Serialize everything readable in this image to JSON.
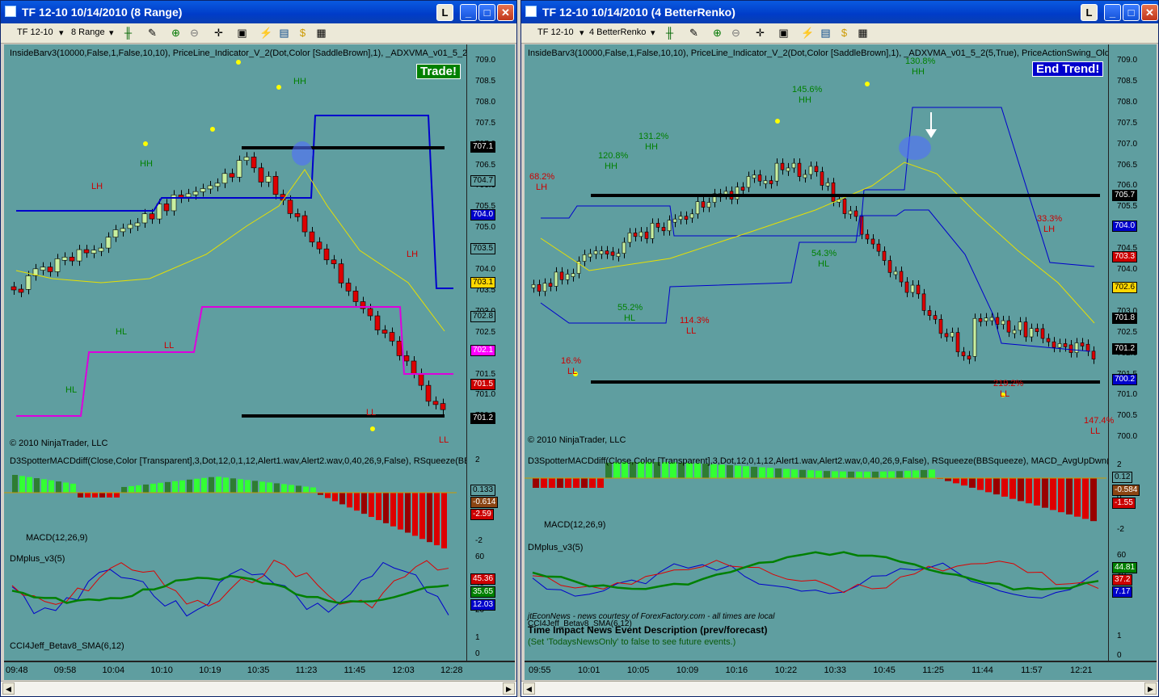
{
  "left": {
    "title": "TF 12-10  10/14/2010 (8 Range)",
    "toolbar": {
      "instrument": "TF 12-10",
      "period": "8 Range"
    },
    "indicator_header": "InsideBarv3(10000,False,1,False,10,10), PriceLine_Indicator_V_2(Dot,Color [SaddleBrown],1), _ADXVMA_v01_5_2(5,True), Pric",
    "signal": "Trade!",
    "copyright": "© 2010 NinjaTrader, LLC",
    "price_ticks": [
      "709.0",
      "708.5",
      "708.0",
      "707.5",
      "707.0",
      "706.5",
      "706.0",
      "705.5",
      "705.0",
      "704.5",
      "704.0",
      "703.5",
      "703.0",
      "702.5",
      "702.0",
      "701.5",
      "701.0",
      "700.5"
    ],
    "price_tags": [
      {
        "text": "707.1",
        "bg": "#000000",
        "fg": "#ffffff"
      },
      {
        "text": "704.7",
        "bg": "#5f9ea0",
        "fg": "#000000"
      },
      {
        "text": "704.0",
        "bg": "#0000cc",
        "fg": "#ffffff"
      },
      {
        "text": "703.5",
        "bg": "#5f9ea0",
        "fg": "#000000"
      },
      {
        "text": "703.1",
        "bg": "#ffd700",
        "fg": "#000000"
      },
      {
        "text": "702.8",
        "bg": "#5f9ea0",
        "fg": "#000000"
      },
      {
        "text": "702.1",
        "bg": "#ff00ff",
        "fg": "#ffffff"
      },
      {
        "text": "701.5",
        "bg": "#cc0000",
        "fg": "#ffffff"
      },
      {
        "text": "701.2",
        "bg": "#000000",
        "fg": "#ffffff"
      }
    ],
    "labels": [
      "HH",
      "HH",
      "LH",
      "HL",
      "LL",
      "HL",
      "LH",
      "LL",
      "LL"
    ],
    "macd_header": "D3SpotterMACDdiff(Close,Color [Transparent],3,Dot,12,0,1,12,Alert1.wav,Alert2.wav,0,40,26,9,False), RSqueeze(BBSqueeze), M",
    "macd_label": "MACD(12,26,9)",
    "macd_ticks": [
      "2",
      "0",
      "-2"
    ],
    "macd_tags": [
      {
        "text": "0.133",
        "bg": "#5f9ea0",
        "fg": "#000000"
      },
      {
        "text": "-0.614",
        "bg": "#8b4513",
        "fg": "#ffffff"
      },
      {
        "text": "-2.59",
        "bg": "#cc0000",
        "fg": "#ffffff"
      }
    ],
    "dm_label": "DMplus_v3(5)",
    "dm_ticks": [
      "60",
      "40",
      "20"
    ],
    "dm_tags": [
      {
        "text": "45.36",
        "bg": "#cc0000",
        "fg": "#ffffff"
      },
      {
        "text": "35.65",
        "bg": "#008000",
        "fg": "#ffffff"
      },
      {
        "text": "12.03",
        "bg": "#0000cc",
        "fg": "#ffffff"
      }
    ],
    "cci_label": "CCI4Jeff_Betav8_SMA(6,12)",
    "cci_ticks": [
      "1",
      "0"
    ],
    "time_ticks": [
      "09:48",
      "09:58",
      "10:04",
      "10:10",
      "10:19",
      "10:35",
      "11:23",
      "11:45",
      "12:03",
      "12:28"
    ]
  },
  "right": {
    "title": "TF 12-10  10/14/2010 (4 BetterRenko)",
    "toolbar": {
      "instrument": "TF 12-10",
      "period": "4 BetterRenko"
    },
    "indicator_header": "InsideBarv3(10000,False,1,False,10,10), PriceLine_Indicator_V_2(Dot,Color [SaddleBrown],1), _ADXVMA_v01_5_2(5,True), PriceActionSwing_Old(Standard,4,1",
    "signal": "End Trend!",
    "copyright": "© 2010 NinjaTrader, LLC",
    "price_ticks": [
      "709.0",
      "708.5",
      "708.0",
      "707.5",
      "707.0",
      "706.5",
      "706.0",
      "705.5",
      "705.0",
      "704.5",
      "704.0",
      "703.5",
      "703.0",
      "702.5",
      "702.0",
      "701.5",
      "701.0",
      "700.5",
      "700.0"
    ],
    "price_tags": [
      {
        "text": "705.7",
        "bg": "#000000",
        "fg": "#ffffff"
      },
      {
        "text": "704.0",
        "bg": "#0000cc",
        "fg": "#ffffff"
      },
      {
        "text": "703.3",
        "bg": "#cc0000",
        "fg": "#ffffff"
      },
      {
        "text": "702.6",
        "bg": "#ffd700",
        "fg": "#000000"
      },
      {
        "text": "701.8",
        "bg": "#000000",
        "fg": "#ffffff"
      },
      {
        "text": "701.2",
        "bg": "#000000",
        "fg": "#ffffff"
      },
      {
        "text": "700.2",
        "bg": "#0000cc",
        "fg": "#ffffff"
      }
    ],
    "swing_labels": [
      {
        "pct": "68.2%",
        "lab": "LH",
        "color": "#cc0000"
      },
      {
        "pct": "120.8%",
        "lab": "HH",
        "color": "#008000"
      },
      {
        "pct": "131.2%",
        "lab": "HH",
        "color": "#008000"
      },
      {
        "pct": "145.6%",
        "lab": "HH",
        "color": "#008000"
      },
      {
        "pct": "130.8%",
        "lab": "HH",
        "color": "#008000"
      },
      {
        "pct": "54.3%",
        "lab": "HL",
        "color": "#008000"
      },
      {
        "pct": "55.2%",
        "lab": "HL",
        "color": "#008000"
      },
      {
        "pct": "114.3%",
        "lab": "LL",
        "color": "#cc0000"
      },
      {
        "pct": "16.%",
        "lab": "LL",
        "color": "#cc0000"
      },
      {
        "pct": "33.3%",
        "lab": "LH",
        "color": "#cc0000"
      },
      {
        "pct": "219.2%",
        "lab": "LL",
        "color": "#cc0000"
      },
      {
        "pct": "147.4%",
        "lab": "LL",
        "color": "#cc0000"
      }
    ],
    "macd_header": "D3SpotterMACDdiff(Close,Color [Transparent],3,Dot,12,0,1,12,Alert1.wav,Alert2.wav,0,40,26,9,False), RSqueeze(BBSqueeze), MACD_AvgUpDwn(8,17,9)",
    "macd_label": "MACD(12,26,9)",
    "macd_ticks": [
      "2",
      "0",
      "-2"
    ],
    "macd_tags": [
      {
        "text": "0.12",
        "bg": "#5f9ea0",
        "fg": "#000000"
      },
      {
        "text": "-0.584",
        "bg": "#8b4513",
        "fg": "#ffffff"
      },
      {
        "text": "-1.55",
        "bg": "#cc0000",
        "fg": "#ffffff"
      }
    ],
    "dm_label": "DMplus_v3(5)",
    "dm_ticks": [
      "60",
      "40",
      "20"
    ],
    "dm_tags": [
      {
        "text": "44.81",
        "bg": "#008000",
        "fg": "#ffffff"
      },
      {
        "text": "37.2",
        "bg": "#cc0000",
        "fg": "#ffffff"
      },
      {
        "text": "7.17",
        "bg": "#0000cc",
        "fg": "#ffffff"
      }
    ],
    "news_source": "jtEconNews - news courtesy of ForexFactory.com - all times are local",
    "cci_label": "CCI4Jeff_Betav8_SMA(6,12)",
    "news_header": "Time     Impact     News Event Description (prev/forecast)",
    "news_note": "(Set 'TodaysNewsOnly' to false to see future events.)",
    "cci_ticks": [
      "1",
      "0"
    ],
    "time_ticks": [
      "09:55",
      "10:01",
      "10:05",
      "10:09",
      "10:16",
      "10:22",
      "10:33",
      "10:45",
      "11:25",
      "11:44",
      "11:57",
      "12:21"
    ]
  }
}
